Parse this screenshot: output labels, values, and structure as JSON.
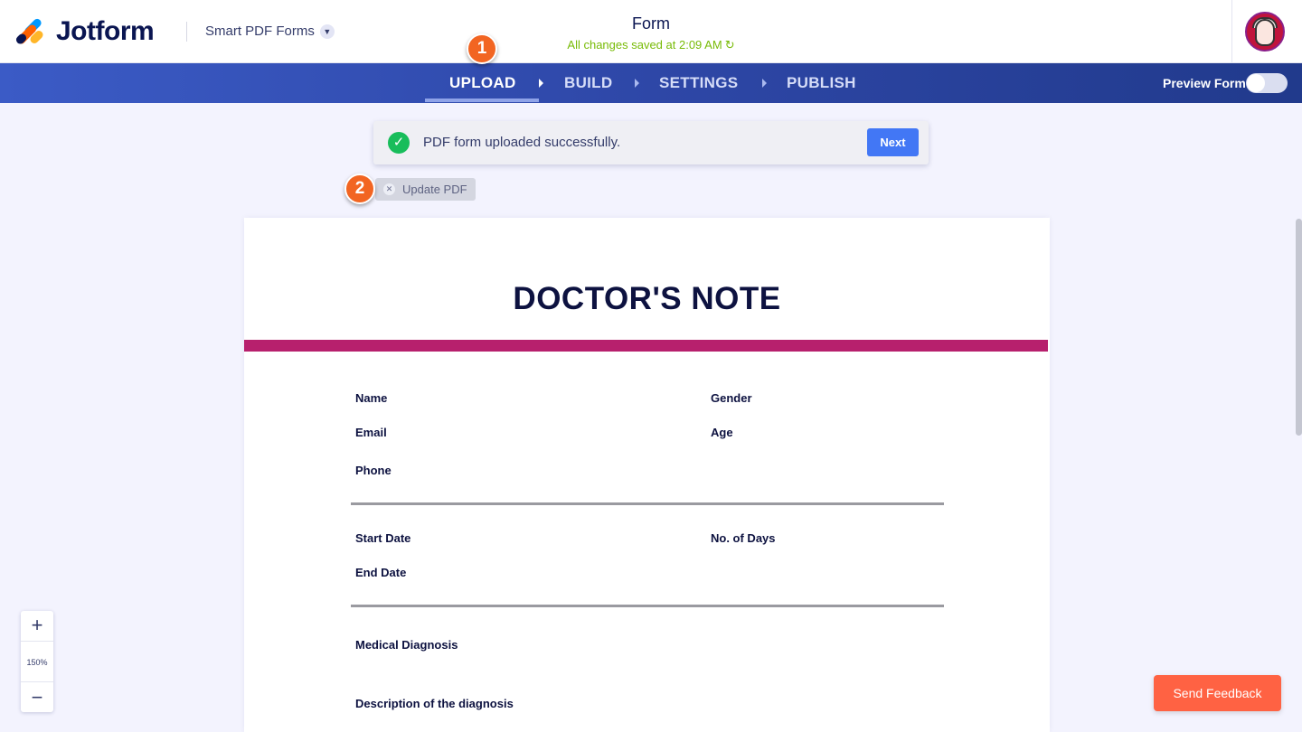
{
  "header": {
    "brand": "Jotform",
    "product": "Smart PDF Forms",
    "form_title": "Form",
    "save_status": "All changes saved at 2:09 AM"
  },
  "steps": [
    {
      "label": "UPLOAD",
      "active": true
    },
    {
      "label": "BUILD",
      "active": false
    },
    {
      "label": "SETTINGS",
      "active": false
    },
    {
      "label": "PUBLISH",
      "active": false
    }
  ],
  "preview": {
    "label": "Preview Form",
    "enabled": false
  },
  "callouts": {
    "one": "1",
    "two": "2"
  },
  "toast": {
    "message": "PDF form uploaded successfully.",
    "next_label": "Next"
  },
  "update_pdf": {
    "label": "Update PDF"
  },
  "document": {
    "title": "DOCTOR'S NOTE",
    "fields": {
      "name": "Name",
      "gender": "Gender",
      "email": "Email",
      "age": "Age",
      "phone": "Phone",
      "start_date": "Start Date",
      "no_of_days": "No. of Days",
      "end_date": "End Date",
      "medical_diagnosis": "Medical Diagnosis",
      "description": "Description of the diagnosis"
    }
  },
  "zoom": {
    "plus": "+",
    "level": "150%",
    "minus": "−"
  },
  "feedback": {
    "label": "Send Feedback"
  },
  "colors": {
    "brand_navy": "#0a1551",
    "accent_orange": "#f26522",
    "success_green": "#18bd5b",
    "primary_blue": "#4277f5",
    "doc_bar": "#b7206d",
    "feedback": "#ff6243"
  },
  "icons": {
    "saved_refresh": "refresh-icon",
    "toast": "check-circle-icon",
    "chip_close": "close-icon"
  }
}
